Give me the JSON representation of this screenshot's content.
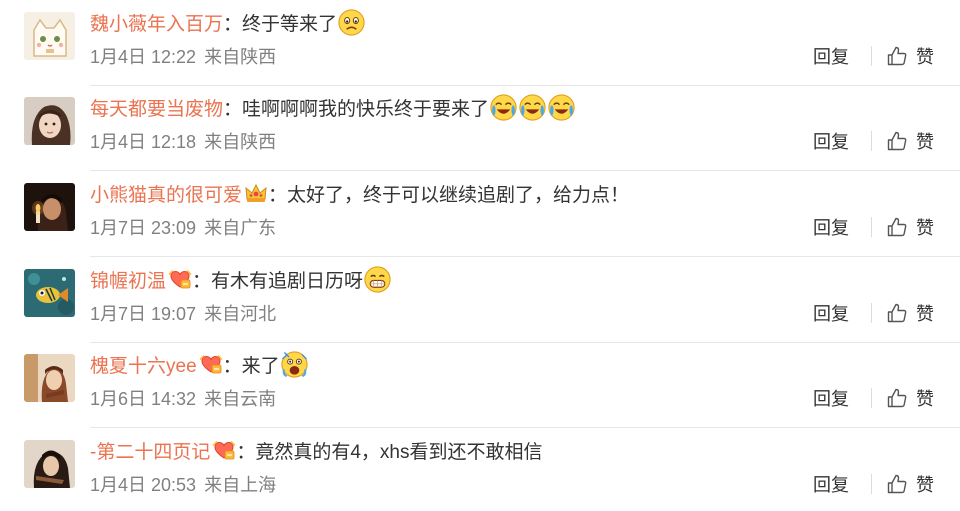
{
  "comments": [
    {
      "username": "魏小薇年入百万",
      "colon": "：",
      "text": "终于等来了",
      "emojis": [
        "frown-emoji"
      ],
      "badge": "",
      "date": "1月4日 12:22",
      "location": "来自陕西",
      "avatar": "cat-avatar",
      "avatar_colors": [
        "#f4e8d8",
        "#e8c28a"
      ]
    },
    {
      "username": "每天都要当废物",
      "colon": "：",
      "text": "哇啊啊啊我的快乐终于要来了",
      "emojis": [
        "crying-laugh-emoji",
        "crying-laugh-emoji",
        "crying-laugh-emoji"
      ],
      "badge": "",
      "date": "1月4日 12:18",
      "location": "来自陕西",
      "avatar": "girl-photo-avatar",
      "avatar_colors": [
        "#d9cfc6",
        "#6b4c3a"
      ]
    },
    {
      "username": "小熊猫真的很可爱",
      "colon": "：",
      "text": "太好了，终于可以继续追剧了，给力点！",
      "emojis": [],
      "badge": "crown-badge",
      "date": "1月7日 23:09",
      "location": "来自广东",
      "avatar": "candle-photo-avatar",
      "avatar_colors": [
        "#2b1a14",
        "#c98a5a"
      ]
    },
    {
      "username": "锦幄初温",
      "colon": "：",
      "text": "有木有追剧日历呀",
      "emojis": [
        "grin-emoji"
      ],
      "badge": "heart-badge",
      "date": "1月7日 19:07",
      "location": "来自河北",
      "avatar": "fish-art-avatar",
      "avatar_colors": [
        "#2c6b74",
        "#e8c23a"
      ]
    },
    {
      "username": "槐夏十六yee",
      "colon": "：",
      "text": "来了",
      "emojis": [
        "shock-emoji"
      ],
      "badge": "heart-badge",
      "date": "1月6日 14:32",
      "location": "来自云南",
      "avatar": "woman-photo-avatar",
      "avatar_colors": [
        "#e6d2b8",
        "#8a4a2a"
      ]
    },
    {
      "username": "-第二十四页记",
      "colon": "：",
      "text": "竟然真的有4，xhs看到还不敢相信",
      "emojis": [],
      "badge": "heart-badge",
      "date": "1月4日 20:53",
      "location": "来自上海",
      "avatar": "dark-photo-avatar",
      "avatar_colors": [
        "#3a2a22",
        "#d8b89a"
      ]
    }
  ],
  "actions": {
    "reply_label": "回复",
    "like_label": "赞",
    "like_icon": "thumbs-up-icon"
  },
  "colors": {
    "username": "#eb7350",
    "text": "#333333",
    "meta": "#808080",
    "divider": "#e6e6e6"
  }
}
